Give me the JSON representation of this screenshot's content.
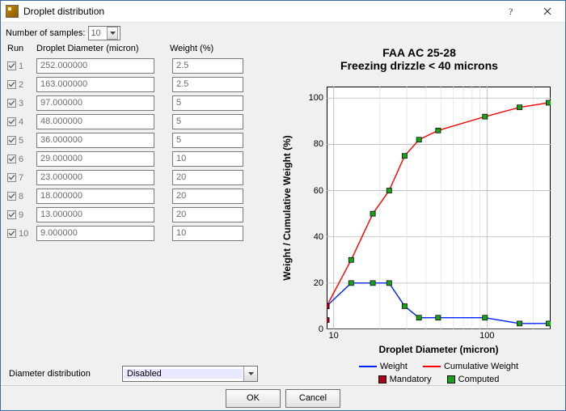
{
  "window": {
    "title": "Droplet distribution"
  },
  "labels": {
    "num_samples": "Number of samples:",
    "num_samples_value": "10",
    "col_run": "Run",
    "col_dia": "Droplet Diameter (micron)",
    "col_wt": "Weight (%)",
    "diam_dist": "Diameter distribution",
    "diam_dist_value": "Disabled",
    "ok": "OK",
    "cancel": "Cancel"
  },
  "rows": [
    {
      "run": "1",
      "dia": "252.000000",
      "wt": "2.5"
    },
    {
      "run": "2",
      "dia": "163.000000",
      "wt": "2.5"
    },
    {
      "run": "3",
      "dia": "97.000000",
      "wt": "5"
    },
    {
      "run": "4",
      "dia": "48.000000",
      "wt": "5"
    },
    {
      "run": "5",
      "dia": "36.000000",
      "wt": "5"
    },
    {
      "run": "6",
      "dia": "29.000000",
      "wt": "10"
    },
    {
      "run": "7",
      "dia": "23.000000",
      "wt": "20"
    },
    {
      "run": "8",
      "dia": "18.000000",
      "wt": "20"
    },
    {
      "run": "9",
      "dia": "13.000000",
      "wt": "20"
    },
    {
      "run": "10",
      "dia": "9.000000",
      "wt": "10"
    }
  ],
  "chart": {
    "title_l1": "FAA AC 25-28",
    "title_l2": "Freezing drizzle    < 40 microns",
    "xlabel": "Droplet Diameter (micron)",
    "ylabel": "Weight / Cumulative Weight (%)",
    "legend": {
      "weight": "Weight",
      "cum": "Cumulative Weight",
      "mand": "Mandatory",
      "comp": "Computed"
    },
    "yticks": [
      "0",
      "20",
      "40",
      "60",
      "80",
      "100"
    ],
    "xticks": [
      "10",
      "100"
    ],
    "colors": {
      "weight": "#0021ff",
      "cum": "#ff0000",
      "mand_fill": "#b00018",
      "comp_fill": "#18a018"
    }
  },
  "chart_data": {
    "type": "line",
    "xscale": "log",
    "xlim": [
      9,
      260
    ],
    "ylim": [
      0,
      105
    ],
    "title": "FAA AC 25-28 — Freezing drizzle < 40 microns",
    "xlabel": "Droplet Diameter (micron)",
    "ylabel": "Weight / Cumulative Weight (%)",
    "x": [
      9,
      13,
      18,
      23,
      29,
      36,
      48,
      97,
      163,
      252
    ],
    "series": [
      {
        "name": "Weight",
        "color": "#0021ff",
        "marker": "computed",
        "values": [
          10,
          20,
          20,
          20,
          10,
          5,
          5,
          5,
          2.5,
          2.5
        ]
      },
      {
        "name": "Cumulative Weight",
        "color": "#ff0000",
        "marker": "computed",
        "values": [
          10,
          30,
          50,
          60,
          75,
          82,
          86,
          92,
          96,
          98
        ]
      }
    ],
    "mandatory_points": [
      {
        "x": 9,
        "y": 4
      },
      {
        "x": 9,
        "y": 10
      }
    ],
    "legend_markers": [
      {
        "label": "Mandatory",
        "shape": "square",
        "fill": "#b00018",
        "stroke": "#000"
      },
      {
        "label": "Computed",
        "shape": "square",
        "fill": "#18a018",
        "stroke": "#000"
      }
    ]
  }
}
